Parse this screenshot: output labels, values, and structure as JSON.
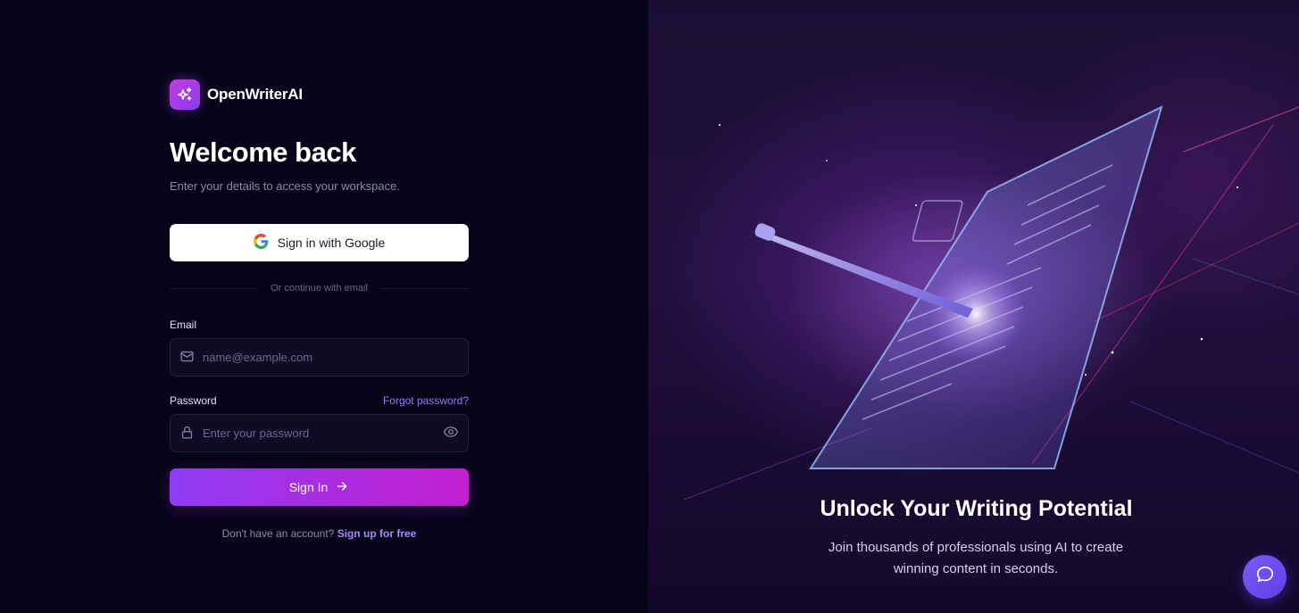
{
  "brand": {
    "name": "OpenWriterAI",
    "icon": "sparkles-icon"
  },
  "login": {
    "title": "Welcome back",
    "subtitle": "Enter your details to access your workspace.",
    "google_button": "Sign in with Google",
    "divider_text": "Or continue with email",
    "email_label": "Email",
    "email_placeholder": "name@example.com",
    "password_label": "Password",
    "forgot_password": "Forgot password?",
    "password_placeholder": "Enter your password",
    "signin_button": "Sign In",
    "no_account_text": "Don't have an account?",
    "signup_link": "Sign up for free"
  },
  "hero": {
    "title": "Unlock Your Writing Potential",
    "subtitle": "Join thousands of professionals using AI to create winning content in seconds."
  },
  "colors": {
    "accent_start": "#8f3cf2",
    "accent_end": "#c21fcf",
    "link": "#9a7cf5",
    "chat_button": "#6b4cf0"
  },
  "icons": [
    "google-icon",
    "mail-icon",
    "lock-icon",
    "eye-icon",
    "arrow-right-icon",
    "chat-bubble-icon"
  ]
}
